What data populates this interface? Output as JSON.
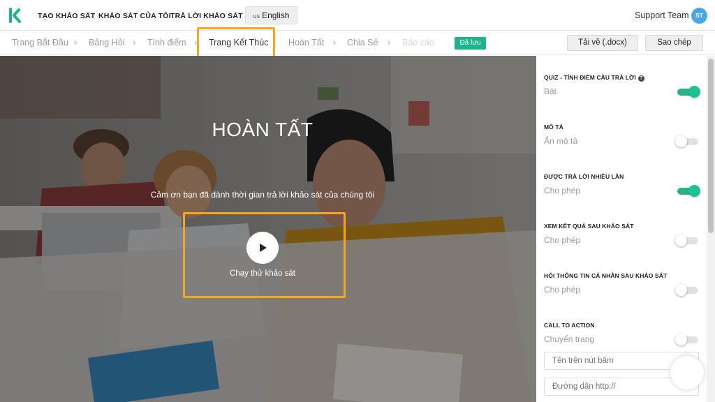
{
  "topnav": {
    "items": [
      "TẠO KHẢO SÁT",
      "KHẢO SÁT CỦA TÔI",
      "TRẢ LỜI KHẢO SÁT"
    ],
    "language_flag": "us",
    "language": "English",
    "user_name": "Support Team",
    "user_initials": "ST"
  },
  "breadcrumb": {
    "steps": [
      "Trang Bắt Đầu",
      "Bảng Hỏi",
      "Tính điểm",
      "Trang Kết Thúc",
      "Hoàn Tất",
      "Chia Sẻ",
      "Báo cáo"
    ],
    "active_index": 3,
    "saved_badge": "Đã lưu",
    "download_label": "Tải về (.docx)",
    "copy_label": "Sao chép"
  },
  "hero": {
    "title": "HOÀN TẤT",
    "subtitle": "Cảm ơn bạn đã dành thời gian trả lời khảo sát của chúng tôi",
    "play_label": "Chạy thử khảo sát"
  },
  "settings": [
    {
      "title": "QUIZ - TÍNH ĐIỂM CÂU TRẢ LỜI",
      "value": "Bật",
      "on": true,
      "help": true
    },
    {
      "title": "MÔ TẢ",
      "value": "Ẩn mô tả",
      "on": false
    },
    {
      "title": "ĐƯỢC TRẢ LỜI NHIỀU LẦN",
      "value": "Cho phép",
      "on": true
    },
    {
      "title": "XEM KẾT QUẢ SAU KHẢO SÁT",
      "value": "Cho phép",
      "on": false
    },
    {
      "title": "HỎI THÔNG TIN CÁ NHÂN SAU KHẢO SÁT",
      "value": "Cho phép",
      "on": false
    },
    {
      "title": "CALL TO ACTION",
      "value": "Chuyển trang",
      "on": false
    }
  ],
  "cta": {
    "button_placeholder": "Tên trên nút bấm",
    "url_placeholder": "Đường dẫn http://"
  },
  "colors": {
    "accent": "#1cb48c",
    "highlight": "#f5a623",
    "avatar": "#4aa7e6"
  }
}
